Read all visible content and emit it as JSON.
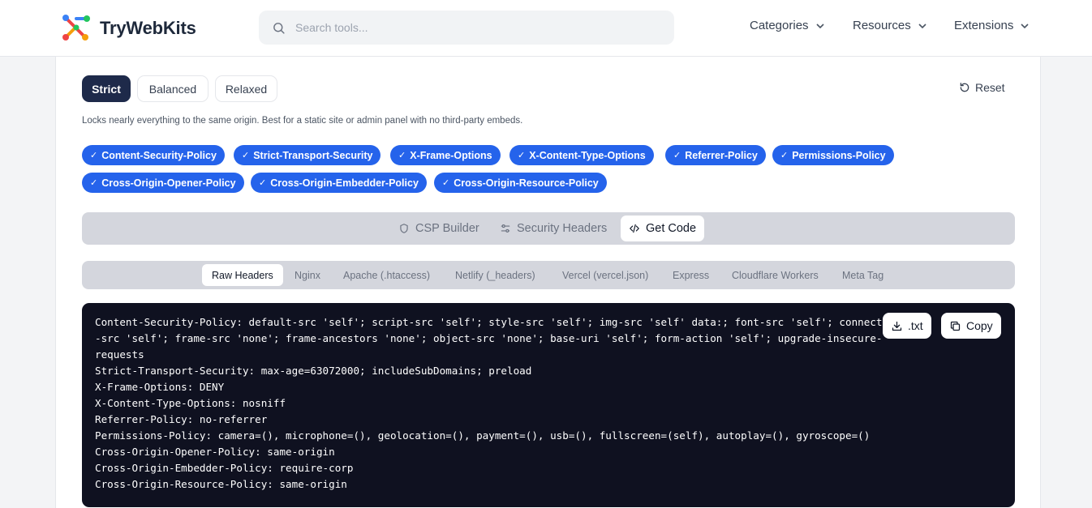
{
  "brand": {
    "name": "TryWebKits"
  },
  "search": {
    "placeholder": "Search tools..."
  },
  "nav": [
    {
      "label": "Categories"
    },
    {
      "label": "Resources"
    },
    {
      "label": "Extensions"
    }
  ],
  "presets": [
    {
      "label": "Strict",
      "active": true
    },
    {
      "label": "Balanced",
      "active": false
    },
    {
      "label": "Relaxed",
      "active": false
    }
  ],
  "reset_label": "Reset",
  "description": "Locks nearly everything to the same origin. Best for a static site or admin panel with no third-party embeds.",
  "headers_selected": [
    "Content-Security-Policy",
    "Strict-Transport-Security",
    "X-Frame-Options",
    "X-Content-Type-Options",
    "Referrer-Policy",
    "Permissions-Policy",
    "Cross-Origin-Opener-Policy",
    "Cross-Origin-Embedder-Policy",
    "Cross-Origin-Resource-Policy"
  ],
  "tabs": [
    {
      "label": "CSP Builder",
      "icon": "shield-icon",
      "active": false
    },
    {
      "label": "Security Headers",
      "icon": "sliders-icon",
      "active": false
    },
    {
      "label": "Get Code",
      "icon": "code-icon",
      "active": true
    }
  ],
  "formats": [
    {
      "label": "Raw Headers",
      "active": true
    },
    {
      "label": "Nginx",
      "active": false
    },
    {
      "label": "Apache (.htaccess)",
      "active": false
    },
    {
      "label": "Netlify (_headers)",
      "active": false
    },
    {
      "label": "Vercel (vercel.json)",
      "active": false
    },
    {
      "label": "Express",
      "active": false
    },
    {
      "label": "Cloudflare Workers",
      "active": false
    },
    {
      "label": "Meta Tag",
      "active": false
    }
  ],
  "code": {
    "download_label": ".txt",
    "copy_label": "Copy",
    "lines": [
      "Content-Security-Policy: default-src 'self'; script-src 'self'; style-src 'self'; img-src 'self' data:; font-src 'self'; connect",
      "-src 'self'; frame-src 'none'; frame-ancestors 'none'; object-src 'none'; base-uri 'self'; form-action 'self'; upgrade-insecure-",
      "requests",
      "Strict-Transport-Security: max-age=63072000; includeSubDomains; preload",
      "X-Frame-Options: DENY",
      "X-Content-Type-Options: nosniff",
      "Referrer-Policy: no-referrer",
      "Permissions-Policy: camera=(), microphone=(), geolocation=(), payment=(), usb=(), fullscreen=(self), autoplay=(), gyroscope=()",
      "Cross-Origin-Opener-Policy: same-origin",
      "Cross-Origin-Embedder-Policy: require-corp",
      "Cross-Origin-Resource-Policy: same-origin"
    ]
  },
  "colors": {
    "accent": "#2563eb",
    "preset_active": "#1e2a4a",
    "code_bg": "#0f1120"
  }
}
